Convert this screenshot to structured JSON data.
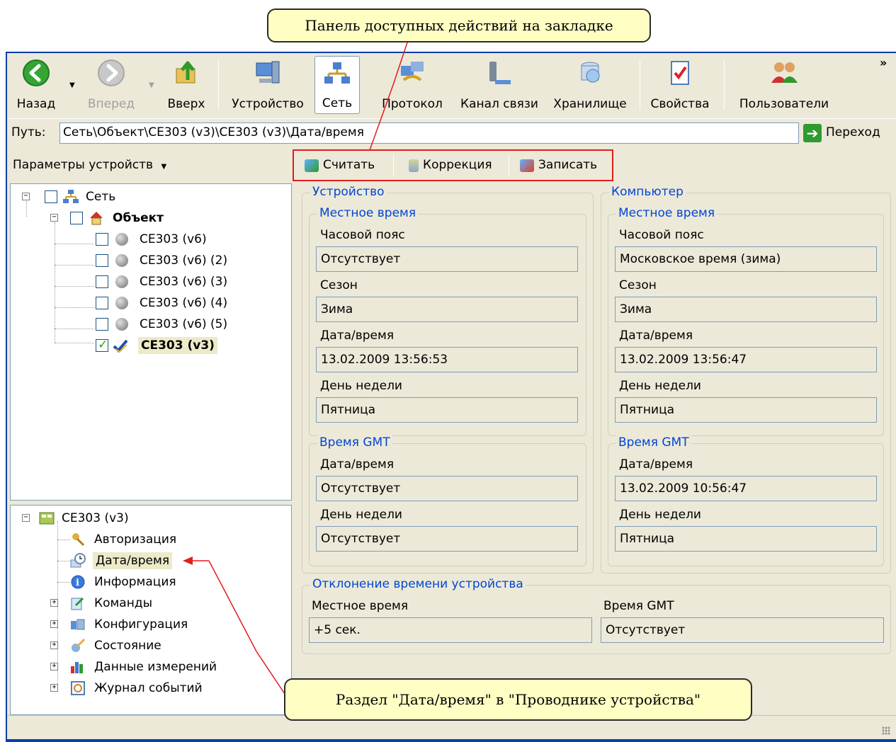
{
  "callouts": {
    "top": "Панель доступных действий на закладке",
    "bottom": "Раздел \"Дата/время\" в \"Проводнике устройства\""
  },
  "toolbar": {
    "back": "Назад",
    "forward": "Вперед",
    "up": "Вверх",
    "device": "Устройство",
    "network": "Сеть",
    "protocol": "Протокол",
    "channel": "Канал связи",
    "storage": "Хранилище",
    "properties": "Свойства",
    "users": "Пользователи",
    "overflow": "»"
  },
  "pathbar": {
    "label": "Путь:",
    "value": "Сеть\\Объект\\СЕ303 (v3)\\СЕ303 (v3)\\Дата/время",
    "go": "Переход"
  },
  "params_dropdown": "Параметры устройств",
  "actions": {
    "read": "Считать",
    "correct": "Коррекция",
    "write": "Записать"
  },
  "network_tree": {
    "root": "Сеть",
    "object": "Объект",
    "devices": [
      "СЕ303 (v6)",
      "СЕ303 (v6) (2)",
      "СЕ303 (v6) (3)",
      "СЕ303 (v6) (4)",
      "СЕ303 (v6) (5)"
    ],
    "selected_device": "СЕ303 (v3)"
  },
  "device_tree": {
    "root": "СЕ303 (v3)",
    "items": [
      "Авторизация",
      "Дата/время",
      "Информация",
      "Команды",
      "Конфигурация",
      "Состояние",
      "Данные измерений",
      "Журнал событий"
    ]
  },
  "device_panel": {
    "title": "Устройство",
    "local_title": "Местное время",
    "tz_label": "Часовой пояс",
    "tz_value": "Отсутствует",
    "season_label": "Сезон",
    "season_value": "Зима",
    "datetime_label": "Дата/время",
    "datetime_value": "13.02.2009 13:56:53",
    "weekday_label": "День недели",
    "weekday_value": "Пятница",
    "gmt_title": "Время GMT",
    "gmt_datetime_label": "Дата/время",
    "gmt_datetime_value": "Отсутствует",
    "gmt_weekday_label": "День недели",
    "gmt_weekday_value": "Отсутствует"
  },
  "computer_panel": {
    "title": "Компьютер",
    "local_title": "Местное время",
    "tz_label": "Часовой пояс",
    "tz_value": "Московское время (зима)",
    "season_label": "Сезон",
    "season_value": "Зима",
    "datetime_label": "Дата/время",
    "datetime_value": "13.02.2009 13:56:47",
    "weekday_label": "День недели",
    "weekday_value": "Пятница",
    "gmt_title": "Время GMT",
    "gmt_datetime_label": "Дата/время",
    "gmt_datetime_value": "13.02.2009 10:56:47",
    "gmt_weekday_label": "День недели",
    "gmt_weekday_value": "Пятница"
  },
  "deviation": {
    "title": "Отклонение времени устройства",
    "local_label": "Местное время",
    "local_value": "+5 сек.",
    "gmt_label": "Время GMT",
    "gmt_value": "Отсутствует"
  },
  "colors": {
    "window_border": "#0b3ea8",
    "chrome": "#ece9d8",
    "group_title": "#0046d5",
    "highlight": "#e01e1e",
    "callout_fill": "#ffffc4"
  }
}
